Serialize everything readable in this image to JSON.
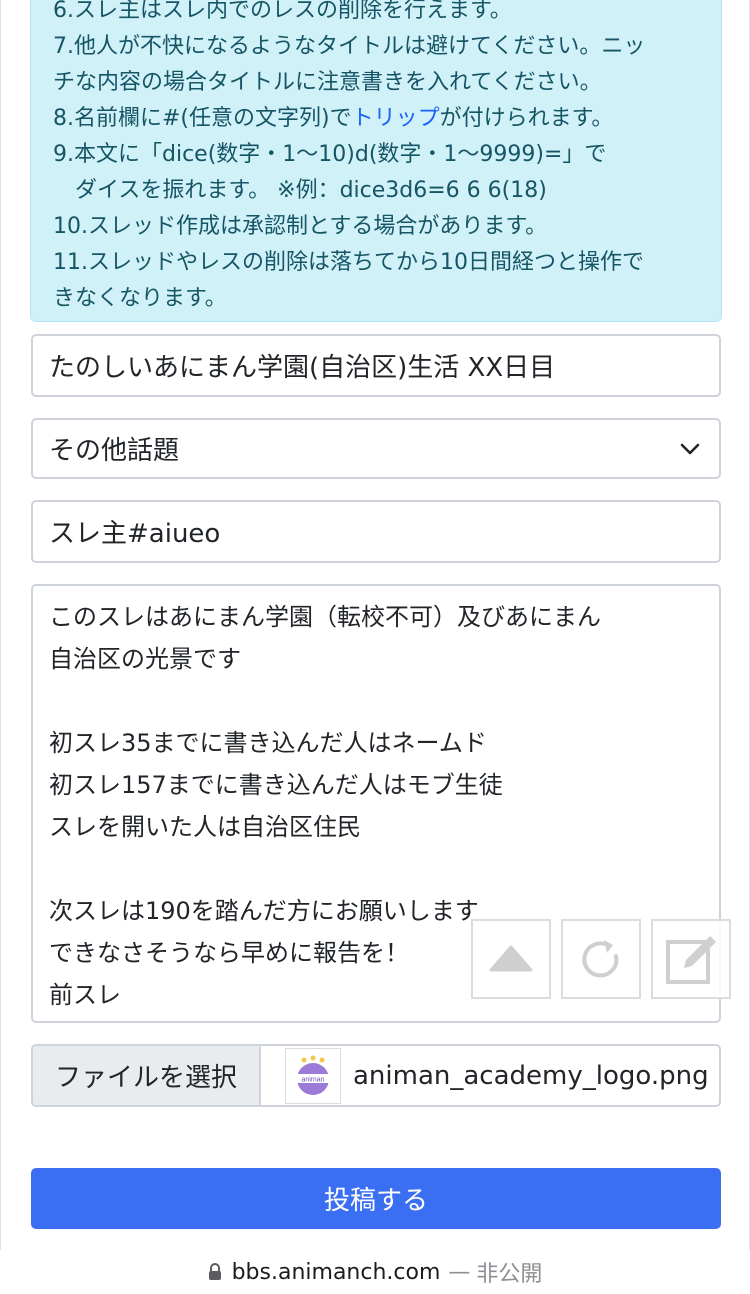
{
  "rules": {
    "line6": "6.スレ主はスレ内でのレスの削除を行えます。",
    "line7a": "7.他人が不快になるようなタイトルは避けてください。ニッ",
    "line7b": "チな内容の場合タイトルに注意書きを入れてください。",
    "line8_prefix": "8.名前欄に#(任意の文字列)で",
    "line8_link": "トリップ",
    "line8_suffix": "が付けられます。",
    "line9a": "9.本文に「dice(数字・1〜10)d(数字・1〜9999)=」で",
    "line9b": "ダイスを振れます。 ※例：dice3d6=6 6 6(18)",
    "line10": "10.スレッド作成は承認制とする場合があります。",
    "line11a": "11.スレッドやレスの削除は落ちてから10日間経つと操作で",
    "line11b": "きなくなります。"
  },
  "form": {
    "title_value": "たのしいあにまん学園(自治区)生活 XX日目",
    "category_value": "その他話題",
    "name_value": "スレ主#aiueo",
    "body_lines": [
      "このスレはあにまん学園（転校不可）及びあにまん",
      "自治区の光景です",
      "",
      "初スレ35までに書き込んだ人はネームド",
      "初スレ157までに書き込んだ人はモブ生徒",
      "スレを開いた人は自治区住民",
      "",
      "次スレは190を踏んだ方にお願いします",
      "できなさそうなら早めに報告を！",
      "前スレ"
    ],
    "file_button_label": "ファイルを選択",
    "file_name": "animan_academy_logo.png",
    "thumb_text": "animan",
    "submit_label": "投稿する"
  },
  "icons": {
    "up": "triangle-up-icon",
    "reload": "reload-icon",
    "edit": "edit-icon",
    "chevron": "chevron-down-icon",
    "lock": "lock-icon"
  },
  "browser": {
    "domain": "bbs.animanch.com",
    "separator": "—",
    "privacy": "非公開"
  },
  "colors": {
    "accent": "#3b6ff3",
    "info_bg": "#d1f1f9",
    "link": "#1a62f5"
  }
}
